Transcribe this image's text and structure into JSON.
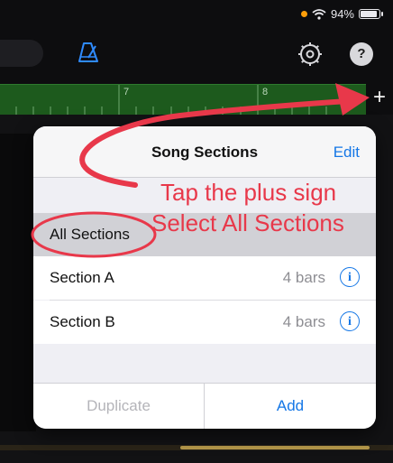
{
  "status_bar": {
    "battery_text": "94%",
    "battery_level": 0.94,
    "recording_dot_color": "#ff9f0a",
    "wifi_icon": "wifi-icon"
  },
  "toolbar": {
    "metronome_icon": "metronome-icon",
    "settings_icon": "settings-icon",
    "help_label": "?"
  },
  "ruler": {
    "markers": [
      "7",
      "8"
    ],
    "add_label": "+"
  },
  "popover": {
    "title": "Song Sections",
    "edit_label": "Edit",
    "rows": [
      {
        "label": "All Sections",
        "selected": true
      },
      {
        "label": "Section A",
        "bars": "4 bars",
        "info_icon": "info-icon"
      },
      {
        "label": "Section B",
        "bars": "4 bars",
        "info_icon": "info-icon"
      }
    ],
    "footer": {
      "duplicate_label": "Duplicate",
      "add_label": "Add"
    }
  },
  "annotations": {
    "line1": "Tap the plus sign",
    "line2": "Select All Sections",
    "color": "#e8384a"
  },
  "colors": {
    "accent": "#1577e6",
    "ruler_green": "#1d5a1d"
  }
}
